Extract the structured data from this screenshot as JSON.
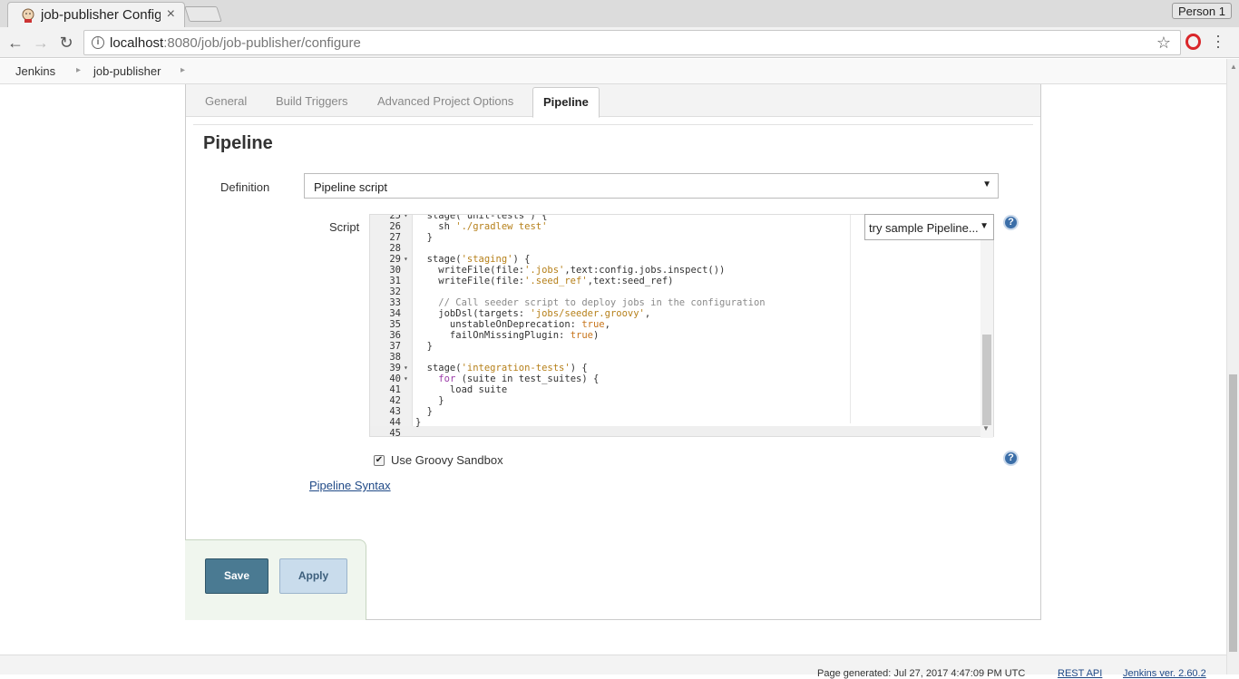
{
  "browser": {
    "tab_title": "job-publisher Configure",
    "tab_close": "×",
    "profile": "Person 1",
    "url_host": "localhost",
    "url_path": ":8080/job/job-publisher/configure",
    "nav": {
      "back": "←",
      "forward": "→",
      "reload": "↻"
    },
    "icons": {
      "info": "info-icon",
      "star": "star-icon",
      "opera": "opera-icon",
      "menu": "menu-icon"
    }
  },
  "breadcrumbs": [
    "Jenkins",
    "job-publisher"
  ],
  "config_tabs": [
    {
      "label": "General",
      "active": false
    },
    {
      "label": "Build Triggers",
      "active": false
    },
    {
      "label": "Advanced Project Options",
      "active": false
    },
    {
      "label": "Pipeline",
      "active": true
    }
  ],
  "pipeline": {
    "title": "Pipeline",
    "definition_label": "Definition",
    "definition_value": "Pipeline script",
    "script_label": "Script",
    "sample_select": "try sample Pipeline...",
    "help": "?",
    "sandbox_label": "Use Groovy Sandbox",
    "sandbox_checked": true,
    "syntax_link": "Pipeline Syntax"
  },
  "editor_lines": [
    {
      "n": "25",
      "fold": "▾",
      "segs": [
        [
          "",
          "  stage('unit-tests') {"
        ]
      ]
    },
    {
      "n": "26",
      "fold": "",
      "segs": [
        [
          "",
          "    sh "
        ],
        [
          "str",
          "'./gradlew test'"
        ]
      ]
    },
    {
      "n": "27",
      "fold": "",
      "segs": [
        [
          "",
          "  }"
        ]
      ]
    },
    {
      "n": "28",
      "fold": "",
      "segs": [
        [
          "",
          ""
        ]
      ]
    },
    {
      "n": "29",
      "fold": "▾",
      "segs": [
        [
          "",
          "  stage("
        ],
        [
          "str",
          "'staging'"
        ],
        [
          "",
          ") {"
        ]
      ]
    },
    {
      "n": "30",
      "fold": "",
      "segs": [
        [
          "",
          "    writeFile(file:"
        ],
        [
          "str",
          "'.jobs'"
        ],
        [
          "",
          ",text:config.jobs.inspect())"
        ]
      ]
    },
    {
      "n": "31",
      "fold": "",
      "segs": [
        [
          "",
          "    writeFile(file:"
        ],
        [
          "str",
          "'.seed_ref'"
        ],
        [
          "",
          ",text:seed_ref)"
        ]
      ]
    },
    {
      "n": "32",
      "fold": "",
      "segs": [
        [
          "",
          ""
        ]
      ]
    },
    {
      "n": "33",
      "fold": "",
      "segs": [
        [
          "cmt",
          "    // Call seeder script to deploy jobs in the configuration"
        ]
      ]
    },
    {
      "n": "34",
      "fold": "",
      "segs": [
        [
          "",
          "    jobDsl(targets: "
        ],
        [
          "str",
          "'jobs/seeder.groovy'"
        ],
        [
          "",
          ","
        ]
      ]
    },
    {
      "n": "35",
      "fold": "",
      "segs": [
        [
          "",
          "      unstableOnDeprecation: "
        ],
        [
          "bool",
          "true"
        ],
        [
          "",
          ","
        ]
      ]
    },
    {
      "n": "36",
      "fold": "",
      "segs": [
        [
          "",
          "      failOnMissingPlugin: "
        ],
        [
          "bool",
          "true"
        ],
        [
          "",
          ")"
        ]
      ]
    },
    {
      "n": "37",
      "fold": "",
      "segs": [
        [
          "",
          "  }"
        ]
      ]
    },
    {
      "n": "38",
      "fold": "",
      "segs": [
        [
          "",
          ""
        ]
      ]
    },
    {
      "n": "39",
      "fold": "▾",
      "segs": [
        [
          "",
          "  stage("
        ],
        [
          "str",
          "'integration-tests'"
        ],
        [
          "",
          ") {"
        ]
      ]
    },
    {
      "n": "40",
      "fold": "▾",
      "segs": [
        [
          "",
          "    "
        ],
        [
          "kw",
          "for"
        ],
        [
          "",
          " (suite in test_suites) {"
        ]
      ]
    },
    {
      "n": "41",
      "fold": "",
      "segs": [
        [
          "",
          "      load suite"
        ]
      ]
    },
    {
      "n": "42",
      "fold": "",
      "segs": [
        [
          "",
          "    }"
        ]
      ]
    },
    {
      "n": "43",
      "fold": "",
      "segs": [
        [
          "",
          "  }"
        ]
      ]
    },
    {
      "n": "44",
      "fold": "",
      "segs": [
        [
          "",
          "}"
        ]
      ]
    },
    {
      "n": "45",
      "fold": "",
      "segs": [
        [
          "",
          ""
        ]
      ]
    }
  ],
  "buttons": {
    "save": "Save",
    "apply": "Apply"
  },
  "footer": {
    "generated": "Page generated: Jul 27, 2017 4:47:09 PM UTC",
    "rest_api": "REST API",
    "version": "Jenkins ver. 2.60.2"
  },
  "colors": {
    "save_bg": "#4a7a92",
    "apply_bg": "#c9dcec",
    "help_icon": "#3b6ea8",
    "link": "#204a87"
  }
}
